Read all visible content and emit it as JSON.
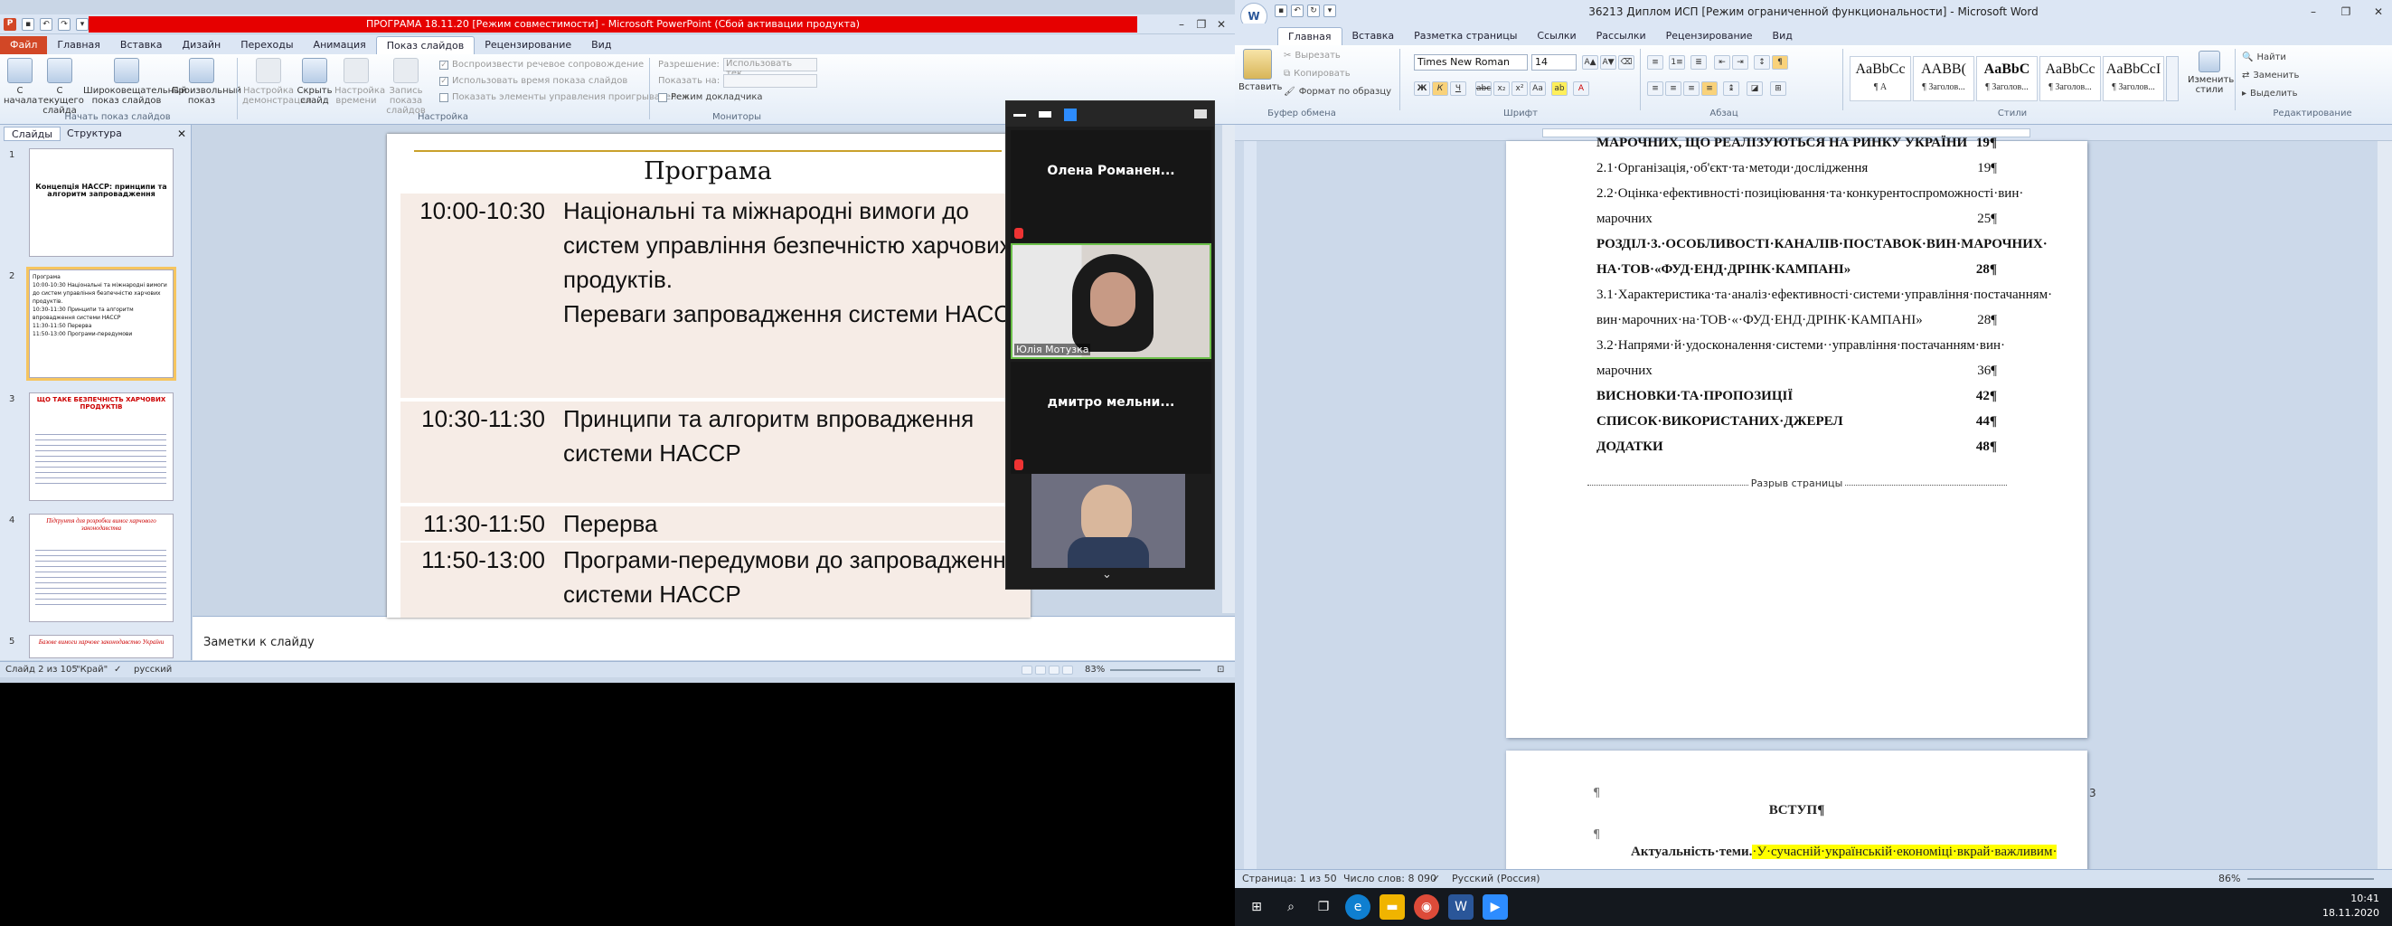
{
  "ppt": {
    "title": "ПРОГРАМА 18.11.20 [Режим совместимости] - Microsoft PowerPoint (Сбой активации продукта)",
    "tabs": [
      "Файл",
      "Главная",
      "Вставка",
      "Дизайн",
      "Переходы",
      "Анимация",
      "Показ слайдов",
      "Рецензирование",
      "Вид"
    ],
    "ribbon": {
      "from_start": "С начала",
      "from_current": "С текущего слайда",
      "broadcast": "Широковещательный показ слайдов",
      "custom_show": "Произвольный показ",
      "setup": "Настройка демонстрации",
      "hide": "Скрыть слайд",
      "rehearse": "Настройка времени",
      "record": "Запись показа слайдов",
      "group_start": "Начать показ слайдов",
      "group_setup": "Настройка",
      "group_monitors": "Мониторы",
      "chk_narration": "Воспроизвести речевое сопровождение",
      "chk_timings": "Использовать время показа слайдов",
      "chk_media": "Показать элементы управления проигрывателем",
      "resolution_label": "Разрешение:",
      "resolution_value": "Использовать тек...",
      "show_on": "Показать на:",
      "presenter_view": "Режим докладчика"
    },
    "pane_tabs": [
      "Слайды",
      "Структура"
    ],
    "thumbs": [
      {
        "num": "1",
        "text": "Концепція НАССР: принципи та алгоритм запровадження"
      },
      {
        "num": "2",
        "text": "Програма\n10:00-10:30 Національні та міжнародні вимоги до систем управління безпечністю харчових продуктів.\n10:30-11:30 Принципи та алгоритм впровадження системи НАССР\n11:30-11:50 Перерва\n11:50-13:00 Програми-передумови"
      },
      {
        "num": "3",
        "text": "ЩО ТАКЕ БЕЗПЕЧНІСТЬ ХАРЧОВИХ ПРОДУКТІВ"
      },
      {
        "num": "4",
        "text": "Підґрунтя для розробки вимог харчового законодавства"
      },
      {
        "num": "5",
        "text": "Базове вимоги харчове законодавство України"
      }
    ],
    "slide": {
      "heading": "Програма",
      "rows": [
        {
          "time": "10:00-10:30",
          "text": "Національні та міжнародні вимоги до систем управління безпечністю харчових продуктів.",
          "text2": "Переваги запровадження системи НАССР"
        },
        {
          "time": "10:30-11:30",
          "text": "Принципи та алгоритм впровадження системи НАССР",
          "text2": ""
        },
        {
          "time": "11:30-11:50",
          "text": "Перерва",
          "text2": ""
        },
        {
          "time": "11:50-13:00",
          "text": "Програми-передумови до запровадження системи НАССР",
          "text2": ""
        }
      ]
    },
    "notes": "Заметки к слайду",
    "status": {
      "slide": "Слайд 2 из 105",
      "theme": "\"Край\"",
      "lang": "русский",
      "zoom": "83%"
    }
  },
  "zoom": {
    "participants": [
      {
        "name": "Олена  Романен..."
      },
      {
        "name": "Юлія Мотузка"
      },
      {
        "name": "дмитро  мельни..."
      }
    ]
  },
  "word": {
    "title": "36213 Диплом ИСП [Режим ограниченной функциональности] - Microsoft Word",
    "tabs": [
      "Главная",
      "Вставка",
      "Разметка страницы",
      "Ссылки",
      "Рассылки",
      "Рецензирование",
      "Вид"
    ],
    "ribbon": {
      "paste": "Вставить",
      "cut": "Вырезать",
      "copy": "Копировать",
      "format_painter": "Формат по образцу",
      "group_clipboard": "Буфер обмена",
      "font_name": "Times New Roman",
      "font_size": "14",
      "group_font": "Шрифт",
      "group_paragraph": "Абзац",
      "group_styles": "Стили",
      "group_editing": "Редактирование",
      "change_styles": "Изменить стили",
      "find": "Найти",
      "replace": "Заменить",
      "select": "Выделить",
      "styles": [
        {
          "sample": "AaBbCc",
          "name": "¶ А"
        },
        {
          "sample": "AABB(",
          "name": "¶ Заголов..."
        },
        {
          "sample": "AaBbC",
          "name": "¶ Заголов..."
        },
        {
          "sample": "AaBbCc",
          "name": "¶ Заголов..."
        },
        {
          "sample": "AaBbCcI",
          "name": "¶ Заголов..."
        }
      ]
    },
    "toc": [
      {
        "text": "МАРОЧНИХ, ЩО РЕАЛІЗУЮТЬСЯ НА РИНКУ УКРАЇНИ",
        "page": "19¶",
        "bold": true
      },
      {
        "text": "2.1·Організація,·об'єкт·та·методи·дослідження",
        "page": "19¶",
        "bold": false
      },
      {
        "text": "2.2·Оцінка·ефективності·позиціювання·та·конкурентоспроможності·вин·",
        "page": "",
        "bold": false
      },
      {
        "text": "марочних",
        "page": "25¶",
        "bold": false
      },
      {
        "text": "РОЗДІЛ·3.·ОСОБЛИВОСТІ·КАНАЛІВ·ПОСТАВОК·ВИН·МАРОЧНИХ·",
        "page": "",
        "bold": true
      },
      {
        "text": "НА·ТОВ·«ФУД·ЕНД·ДРІНК·КАМПАНІ»",
        "page": "28¶",
        "bold": true
      },
      {
        "text": "3.1·Характеристика·та·аналіз·ефективності·системи·управління·постачанням·",
        "page": "",
        "bold": false
      },
      {
        "text": "вин·марочних·на·ТОВ·«·ФУД·ЕНД·ДРІНК·КАМПАНІ»",
        "page": "28¶",
        "bold": false
      },
      {
        "text": "3.2·Напрями·й·удосконалення·системи··управління·постачанням·вин·",
        "page": "",
        "bold": false
      },
      {
        "text": "марочних",
        "page": "36¶",
        "bold": false
      },
      {
        "text": "ВИСНОВКИ·ТА·ПРОПОЗИЦІЇ",
        "page": "42¶",
        "bold": true
      },
      {
        "text": "СПИСОК·ВИКОРИСТАНИХ·ДЖЕРЕЛ",
        "page": "44¶",
        "bold": true
      },
      {
        "text": "ДОДАТКИ",
        "page": "48¶",
        "bold": true
      }
    ],
    "page_break": "Разрыв страницы",
    "page2": {
      "para": "¶",
      "pagenum": "3",
      "heading": "ВСТУП¶",
      "relevance_label": "Актуальність·теми.",
      "relevance_text": "·У·сучасній·українській·економіці·вкрай·важливим·"
    },
    "status": {
      "page": "Страница: 1 из 50",
      "words": "Число слов: 8 090",
      "lang": "Русский (Россия)",
      "zoom": "86%"
    }
  },
  "taskbar": {
    "time": "10:41",
    "date": "18.11.2020"
  }
}
